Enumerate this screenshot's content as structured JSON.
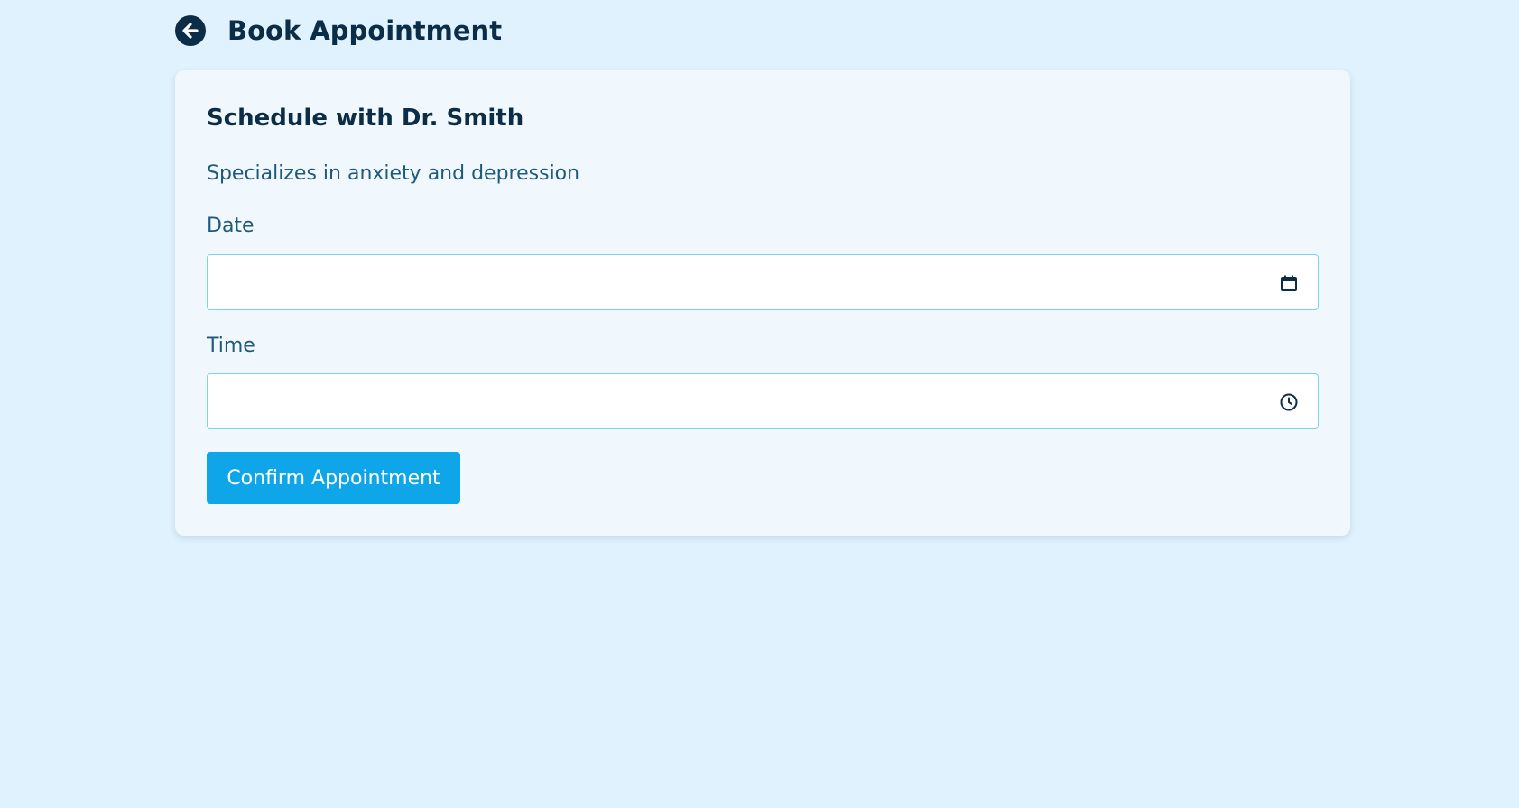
{
  "header": {
    "title": "Book Appointment",
    "back_icon": "arrow-left-circle-icon"
  },
  "card": {
    "title": "Schedule with Dr. Smith",
    "subtitle": "Specializes in anxiety and depression",
    "date_field": {
      "label": "Date",
      "value": "",
      "icon": "calendar-icon"
    },
    "time_field": {
      "label": "Time",
      "value": "",
      "icon": "clock-icon"
    },
    "confirm_label": "Confirm Appointment"
  },
  "colors": {
    "background": "#e0f2fe",
    "card": "#f0f8fe",
    "heading": "#0c2d48",
    "body_text": "#1e5a7a",
    "accent": "#0ea5e9",
    "input_border": "#7dd3e8"
  }
}
